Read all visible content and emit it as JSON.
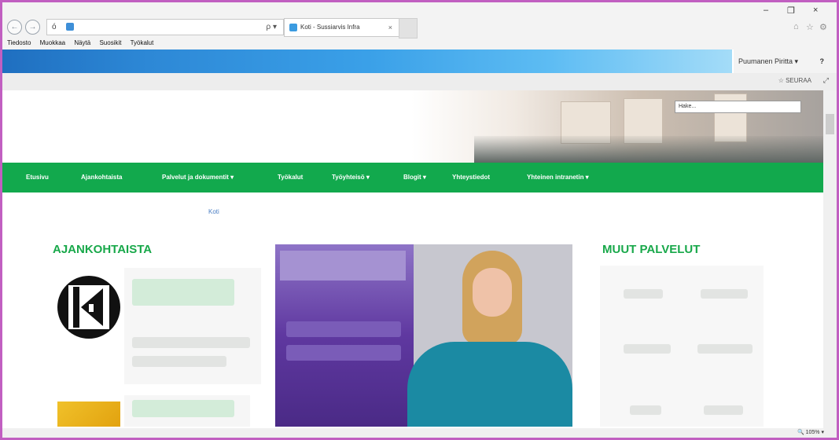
{
  "browser": {
    "address": "ó",
    "search_glyph": "ρ ▾",
    "tab_title": "Koti - Sussiarvis Infra",
    "tab_close": "×",
    "menu": [
      "Tiedosto",
      "Muokkaa",
      "Näytä",
      "Suosikit",
      "Työkalut"
    ],
    "win_minimize": "–",
    "win_restore": "❐",
    "win_close": "×",
    "back": "←",
    "forward": "→",
    "zoom": "105%"
  },
  "sharepoint": {
    "user_name": "Puumanen Piritta ▾",
    "help": "?",
    "follow_label": "SEURAA",
    "focus_glyph": "⤢"
  },
  "site": {
    "search_placeholder": "Hake...",
    "nav": [
      "Etusivu",
      "Ajankohtaista",
      "Palvelut ja dokumentit ▾",
      "Työkalut",
      "Työyhteisö ▾",
      "Blogit ▾",
      "Yhteystiedot",
      "Yhteinen intranetin ▾"
    ],
    "breadcrumb": "Koti",
    "news_heading": "AJANKOHTAISTA",
    "services_heading": "MUUT PALVELUT"
  },
  "colors": {
    "nav_green": "#12a94d",
    "heading_green": "#18a84a",
    "suite_blue": "#2d88d6",
    "frame": "#c15fc1"
  }
}
